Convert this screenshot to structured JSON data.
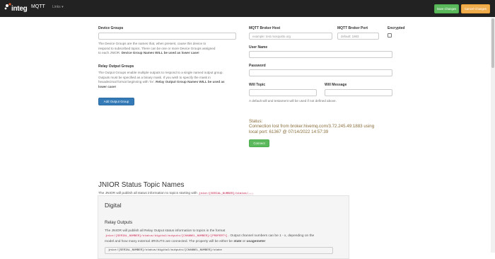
{
  "navbar": {
    "brand": "integ",
    "title": "MQTT",
    "links_label": "Links",
    "save_label": "Save Changes",
    "cancel_label": "Cancel Changes"
  },
  "device_groups": {
    "label": "Device Groups",
    "help_line1": "The Device Groups are the names that, when present, cause this device to",
    "help_line2": "respond to subscribed topics. There can be one or more Device Groups assigned",
    "help_line3": "to each JNIOR.",
    "help_bold": "Device Group Names WILL be used as lower case!"
  },
  "relay_output_groups": {
    "label": "Relay Output Groups",
    "help_line1": "The Output Groups enable multiple outputs to respond to a single named output group.",
    "help_line2": "Outputs must be specified as a binary mask. If you wish to specify the mask in",
    "help_line3": "hexadecimal format beginning with '0x'.",
    "help_bold_a": "Relay Output Group Names WILL be used as",
    "help_bold_b": "lower case!",
    "add_button": "Add Output Group"
  },
  "broker": {
    "host_label": "MQTT Broker Host",
    "host_placeholder": "example: test.mosquitto.org",
    "port_label": "MQTT Broker Port",
    "port_placeholder": "default: 1883",
    "encrypted_label": "Encrypted",
    "user_label": "User Name",
    "password_label": "Password",
    "will_topic_label": "Will Topic",
    "will_message_label": "Will Message",
    "will_help": "A default will and testament will be used if not defined above."
  },
  "status": {
    "label": "Status:",
    "line1": "Connection lost from broker.hivemq.com/3.72.245.49:1883 using",
    "line2": "local port: 61367 @ 07/14/2022 14:57:39",
    "connect_button": "Connect"
  },
  "status_topics": {
    "heading": "JNIOR Status Topic Names",
    "intro": "The JNIOR will publish all status information to topics starting with",
    "intro_code": "jnior/[SERIAL_NUMBER]/status/...",
    "digital_heading": "Digital",
    "relay_heading": "Relay Outputs",
    "relay_text_a": "The JNIOR will publish all Relay Output status information to topics in the format",
    "relay_code": "jnior/[SERIAL_NUMBER]/status/digital/outputs/[CHANNEL_NUMBER]/[PROPERTY]",
    "relay_text_b": ". Output channel numbers can be 1 - x, depending on the",
    "relay_text_c": "model and how many external 4ROUTS are connected. The property will be either be",
    "relay_prop_a": "state",
    "relay_or": "or",
    "relay_prop_b": "usagemeter",
    "pre_line": "jnior/[SERIAL_NUMBER]/status/digital/outputs/[CHANNEL_NUMBER]/state"
  },
  "colors": {
    "navbar_bg": "#222222",
    "save_green": "#5cb85c",
    "cancel_orange": "#f0ad4e",
    "primary_blue": "#337ab7",
    "status_text": "#8a6d3b"
  }
}
